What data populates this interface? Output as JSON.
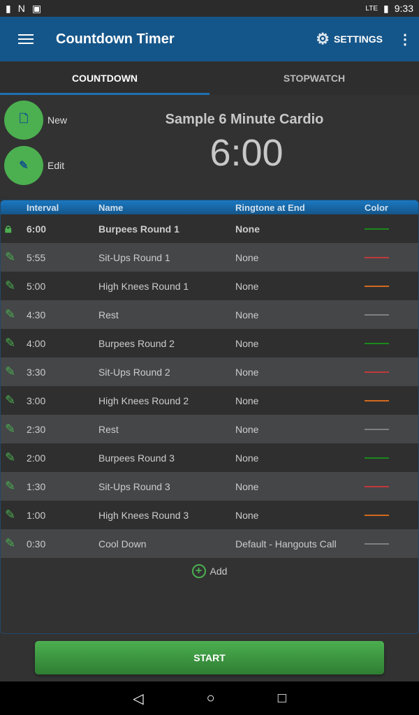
{
  "status": {
    "time": "9:33",
    "network": "LTE"
  },
  "appbar": {
    "title": "Countdown Timer",
    "settings": "SETTINGS"
  },
  "tabs": [
    {
      "label": "COUNTDOWN"
    },
    {
      "label": "STOPWATCH"
    }
  ],
  "actions": {
    "new": "New",
    "edit": "Edit"
  },
  "program": {
    "title": "Sample 6 Minute Cardio",
    "time": "6:00"
  },
  "table": {
    "headers": {
      "interval": "Interval",
      "name": "Name",
      "ringtone": "Ringtone at End",
      "color": "Color"
    },
    "rows": [
      {
        "interval": "6:00",
        "name": "Burpees Round 1",
        "ringtone": "None",
        "color": "#1a8a1a",
        "locked": true
      },
      {
        "interval": "5:55",
        "name": "Sit-Ups Round 1",
        "ringtone": "None",
        "color": "#c0393b"
      },
      {
        "interval": "5:00",
        "name": "High Knees Round 1",
        "ringtone": "None",
        "color": "#d2691e"
      },
      {
        "interval": "4:30",
        "name": "Rest",
        "ringtone": "None",
        "color": "#808080"
      },
      {
        "interval": "4:00",
        "name": "Burpees Round 2",
        "ringtone": "None",
        "color": "#1a8a1a"
      },
      {
        "interval": "3:30",
        "name": "Sit-Ups Round 2",
        "ringtone": "None",
        "color": "#c0393b"
      },
      {
        "interval": "3:00",
        "name": "High Knees Round 2",
        "ringtone": "None",
        "color": "#d2691e"
      },
      {
        "interval": "2:30",
        "name": "Rest",
        "ringtone": "None",
        "color": "#808080"
      },
      {
        "interval": "2:00",
        "name": "Burpees Round 3",
        "ringtone": "None",
        "color": "#1a8a1a"
      },
      {
        "interval": "1:30",
        "name": "Sit-Ups Round 3",
        "ringtone": "None",
        "color": "#c0393b"
      },
      {
        "interval": "1:00",
        "name": "High Knees Round 3",
        "ringtone": "None",
        "color": "#d2691e"
      },
      {
        "interval": "0:30",
        "name": "Cool Down",
        "ringtone": "Default - Hangouts Call",
        "color": "#808080"
      }
    ],
    "add": "Add"
  },
  "start": "START"
}
